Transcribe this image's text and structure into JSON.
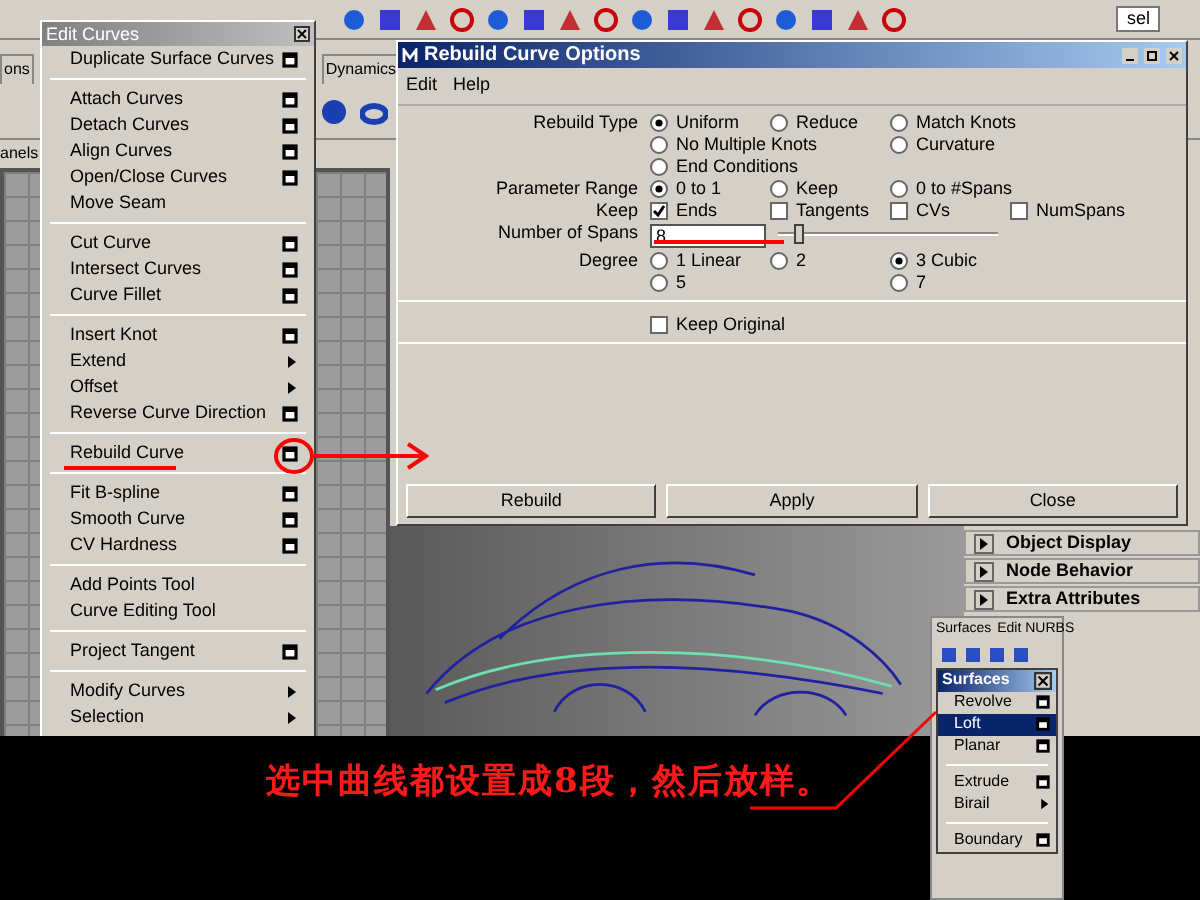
{
  "toolbar": {
    "field_text": "sel"
  },
  "shelf_tabs": [
    {
      "label": "ons"
    },
    {
      "label": "Dynamics"
    }
  ],
  "panel_menu": "anels",
  "edit_curves_menu": {
    "title": "Edit Curves",
    "groups": [
      [
        {
          "label": "Duplicate Surface Curves",
          "kind": "option"
        }
      ],
      [
        {
          "label": "Attach Curves",
          "kind": "option"
        },
        {
          "label": "Detach Curves",
          "kind": "option"
        },
        {
          "label": "Align Curves",
          "kind": "option"
        },
        {
          "label": "Open/Close Curves",
          "kind": "option"
        },
        {
          "label": "Move Seam",
          "kind": "plain"
        }
      ],
      [
        {
          "label": "Cut Curve",
          "kind": "option"
        },
        {
          "label": "Intersect Curves",
          "kind": "option"
        },
        {
          "label": "Curve Fillet",
          "kind": "option"
        }
      ],
      [
        {
          "label": "Insert Knot",
          "kind": "option"
        },
        {
          "label": "Extend",
          "kind": "submenu"
        },
        {
          "label": "Offset",
          "kind": "submenu"
        },
        {
          "label": "Reverse Curve Direction",
          "kind": "option"
        }
      ],
      [
        {
          "label": "Rebuild Curve",
          "kind": "option"
        }
      ],
      [
        {
          "label": "Fit B-spline",
          "kind": "option"
        },
        {
          "label": "Smooth Curve",
          "kind": "option"
        },
        {
          "label": "CV Hardness",
          "kind": "option"
        }
      ],
      [
        {
          "label": "Add Points Tool",
          "kind": "plain"
        },
        {
          "label": "Curve Editing Tool",
          "kind": "plain"
        }
      ],
      [
        {
          "label": "Project Tangent",
          "kind": "option"
        }
      ],
      [
        {
          "label": "Modify Curves",
          "kind": "submenu"
        },
        {
          "label": "Selection",
          "kind": "submenu"
        }
      ]
    ]
  },
  "dialog": {
    "title": "Rebuild Curve Options",
    "menus": [
      "Edit",
      "Help"
    ],
    "rows": [
      {
        "label": "Rebuild Type",
        "kind": "radio",
        "lines": [
          [
            {
              "label": "Uniform",
              "selected": true
            },
            {
              "label": "Reduce",
              "selected": false
            },
            {
              "label": "Match Knots",
              "selected": false
            }
          ],
          [
            {
              "label": "No Multiple Knots",
              "selected": false,
              "wide": true
            },
            {
              "label": "Curvature",
              "selected": false
            }
          ],
          [
            {
              "label": "End Conditions",
              "selected": false
            }
          ]
        ]
      },
      {
        "label": "Parameter Range",
        "kind": "radio",
        "lines": [
          [
            {
              "label": "0 to 1",
              "selected": true
            },
            {
              "label": "Keep",
              "selected": false
            },
            {
              "label": "0 to #Spans",
              "selected": false
            }
          ]
        ]
      },
      {
        "label": "Keep",
        "kind": "checkbox",
        "lines": [
          [
            {
              "label": "Ends",
              "checked": true
            },
            {
              "label": "Tangents",
              "checked": false
            },
            {
              "label": "CVs",
              "checked": false
            },
            {
              "label": "NumSpans",
              "checked": false
            }
          ]
        ]
      },
      {
        "label": "Number of Spans",
        "kind": "spans",
        "value": "8",
        "level": 0.08
      },
      {
        "label": "Degree",
        "kind": "radio",
        "lines": [
          [
            {
              "label": "1 Linear",
              "selected": false
            },
            {
              "label": "2",
              "selected": false
            },
            {
              "label": "3 Cubic",
              "selected": true
            }
          ],
          [
            {
              "label": "5",
              "selected": false,
              "wide": true
            },
            {
              "label": "7",
              "selected": false
            }
          ]
        ]
      }
    ],
    "keep_original": {
      "label": "Keep Original",
      "checked": false
    },
    "buttons": [
      "Rebuild",
      "Apply",
      "Close"
    ]
  },
  "attribute_sections": [
    "Object Display",
    "Node Behavior",
    "Extra Attributes"
  ],
  "surfaces_shelf": {
    "tabs": [
      "Surfaces",
      "Edit NURBS"
    ],
    "menu_title": "Surfaces",
    "groups": [
      [
        {
          "label": "Revolve",
          "kind": "option",
          "selected": false
        },
        {
          "label": "Loft",
          "kind": "option",
          "selected": true
        },
        {
          "label": "Planar",
          "kind": "option",
          "selected": false
        }
      ],
      [
        {
          "label": "Extrude",
          "kind": "option",
          "selected": false
        },
        {
          "label": "Birail",
          "kind": "submenu",
          "selected": false
        }
      ],
      [
        {
          "label": "Boundary",
          "kind": "option",
          "selected": false
        }
      ]
    ]
  },
  "caption": "选中曲线都设置成8段，然后放样。"
}
